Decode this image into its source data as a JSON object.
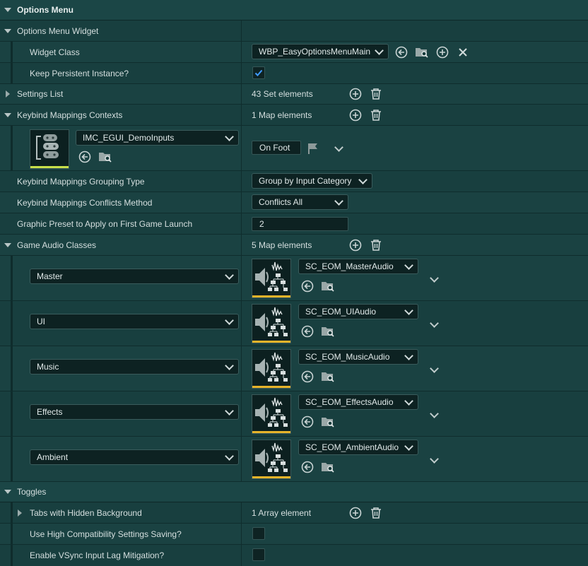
{
  "sections": {
    "options_menu": "Options Menu",
    "toggles": "Toggles"
  },
  "rows": {
    "options_menu_widget": "Options Menu Widget",
    "widget_class": {
      "label": "Widget Class",
      "value": "WBP_EasyOptionsMenuMain"
    },
    "keep_persistent": {
      "label": "Keep Persistent Instance?",
      "checked": true
    },
    "settings_list": {
      "label": "Settings List",
      "count": "43 Set elements"
    },
    "keybind_contexts": {
      "label": "Keybind Mappings Contexts",
      "count": "1 Map elements",
      "asset": "IMC_EGUI_DemoInputs",
      "value": "On Foot"
    },
    "grouping_type": {
      "label": "Keybind Mappings Grouping Type",
      "value": "Group by Input Category"
    },
    "conflicts_method": {
      "label": "Keybind Mappings Conflicts Method",
      "value": "Conflicts All"
    },
    "graphic_preset": {
      "label": "Graphic Preset to Apply on First Game Launch",
      "value": "2"
    },
    "game_audio_classes": {
      "label": "Game Audio Classes",
      "count": "5 Map elements"
    },
    "tabs_hidden_bg": {
      "label": "Tabs with Hidden Background",
      "count": "1 Array element"
    },
    "high_compat": {
      "label": "Use High Compatibility Settings Saving?",
      "checked": false
    },
    "vsync": {
      "label": "Enable VSync Input Lag Mitigation?",
      "checked": false
    }
  },
  "audio_classes": [
    {
      "key": "Master",
      "asset": "SC_EOM_MasterAudio"
    },
    {
      "key": "UI",
      "asset": "SC_EOM_UIAudio"
    },
    {
      "key": "Music",
      "asset": "SC_EOM_MusicAudio"
    },
    {
      "key": "Effects",
      "asset": "SC_EOM_EffectsAudio"
    },
    {
      "key": "Ambient",
      "asset": "SC_EOM_AmbientAudio"
    }
  ],
  "colors": {
    "input_asset_underline": "#c8e04a",
    "sound_asset_underline": "#e6b42a",
    "checkbox_check": "#3f9bff"
  }
}
